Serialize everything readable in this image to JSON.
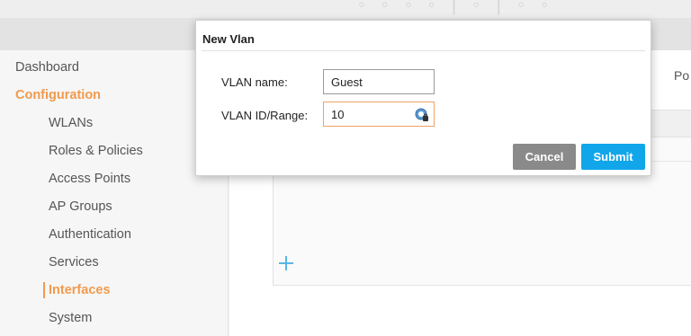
{
  "header": {
    "decoration_text": "◦ ◦ ◦ ◦ | ◦ | ◦ ◦"
  },
  "sidebar": {
    "items": [
      {
        "label": "Dashboard",
        "level": "top",
        "active": false
      },
      {
        "label": "Configuration",
        "level": "top",
        "active": true
      },
      {
        "label": "WLANs",
        "level": "sub",
        "active": false
      },
      {
        "label": "Roles & Policies",
        "level": "sub",
        "active": false
      },
      {
        "label": "Access Points",
        "level": "sub",
        "active": false
      },
      {
        "label": "AP Groups",
        "level": "sub",
        "active": false
      },
      {
        "label": "Authentication",
        "level": "sub",
        "active": false
      },
      {
        "label": "Services",
        "level": "sub",
        "active": false
      },
      {
        "label": "Interfaces",
        "level": "sub",
        "active": true
      },
      {
        "label": "System",
        "level": "sub",
        "active": false
      }
    ]
  },
  "main": {
    "tab_label": "Po",
    "add_icon": "plus-icon"
  },
  "modal": {
    "title": "New Vlan",
    "fields": [
      {
        "label": "VLAN name:",
        "value": "Guest",
        "focused": false
      },
      {
        "label": "VLAN ID/Range:",
        "value": "10",
        "focused": true,
        "icon": "password-manager-icon"
      }
    ],
    "cancel_label": "Cancel",
    "submit_label": "Submit"
  },
  "colors": {
    "accent_orange": "#f09a4e",
    "submit_blue": "#11a6ea",
    "cancel_gray": "#8a8a8a",
    "add_icon_blue": "#59b6e6"
  }
}
